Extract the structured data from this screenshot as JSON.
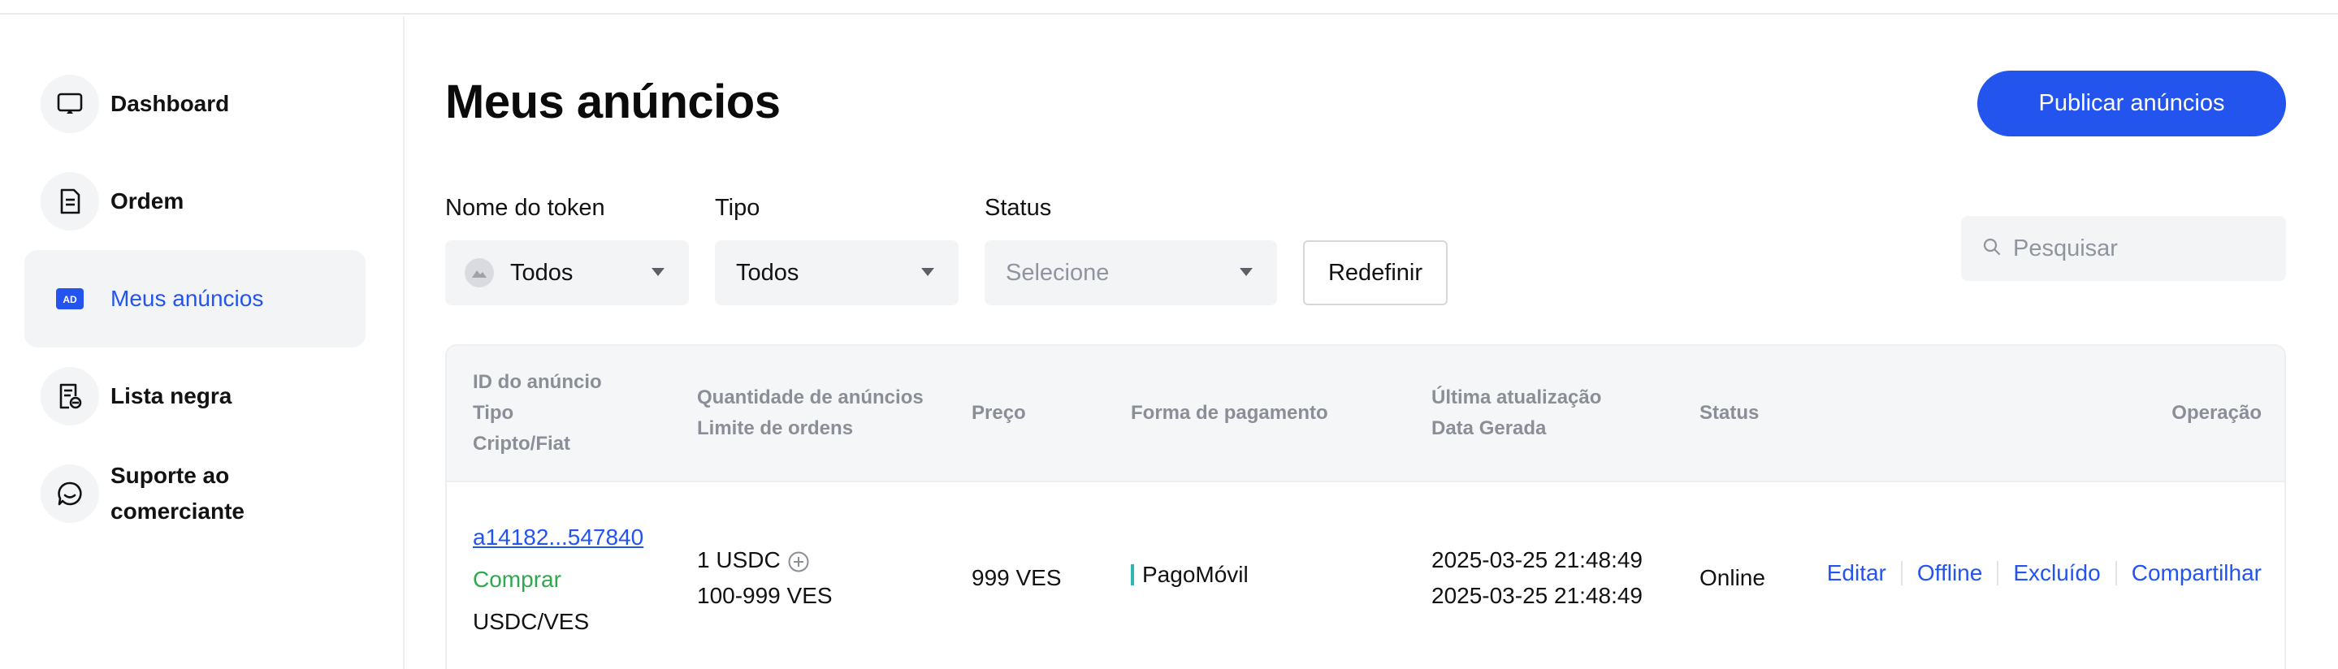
{
  "sidebar": {
    "items": [
      {
        "label": "Dashboard",
        "icon": "monitor-icon"
      },
      {
        "label": "Ordem",
        "icon": "document-icon"
      },
      {
        "label": "Meus anúncios",
        "icon": "ad-icon",
        "active": true
      },
      {
        "label": "Lista negra",
        "icon": "blacklist-icon"
      },
      {
        "label": "Suporte ao comerciante",
        "icon": "chat-icon"
      }
    ]
  },
  "header": {
    "title": "Meus anúncios",
    "publish_label": "Publicar anúncios"
  },
  "filters": {
    "token": {
      "label": "Nome do token",
      "value": "Todos"
    },
    "type": {
      "label": "Tipo",
      "value": "Todos"
    },
    "status": {
      "label": "Status",
      "placeholder": "Selecione"
    },
    "reset_label": "Redefinir",
    "search_placeholder": "Pesquisar"
  },
  "table": {
    "headers": {
      "id_lines": [
        "ID do anúncio",
        "Tipo",
        "Cripto/Fiat"
      ],
      "qty_lines": [
        "Quantidade de anúncios",
        "Limite de ordens"
      ],
      "price": "Preço",
      "payment": "Forma de pagamento",
      "update_lines": [
        "Última atualização",
        "Data Gerada"
      ],
      "status": "Status",
      "operation": "Operação"
    },
    "rows": [
      {
        "ad_id": "a14182...547840",
        "type": "Comprar",
        "pair": "USDC/VES",
        "quantity": "1 USDC",
        "limit": "100-999 VES",
        "price": "999 VES",
        "payment": "PagoMóvil",
        "updated": "2025-03-25 21:48:49",
        "created": "2025-03-25 21:48:49",
        "status": "Online",
        "ops": [
          "Editar",
          "Offline",
          "Excluído",
          "Compartilhar"
        ]
      }
    ]
  },
  "colors": {
    "accent": "#2354ee",
    "buy": "#2fa84f",
    "payment_bar": "#2fb6b0"
  }
}
